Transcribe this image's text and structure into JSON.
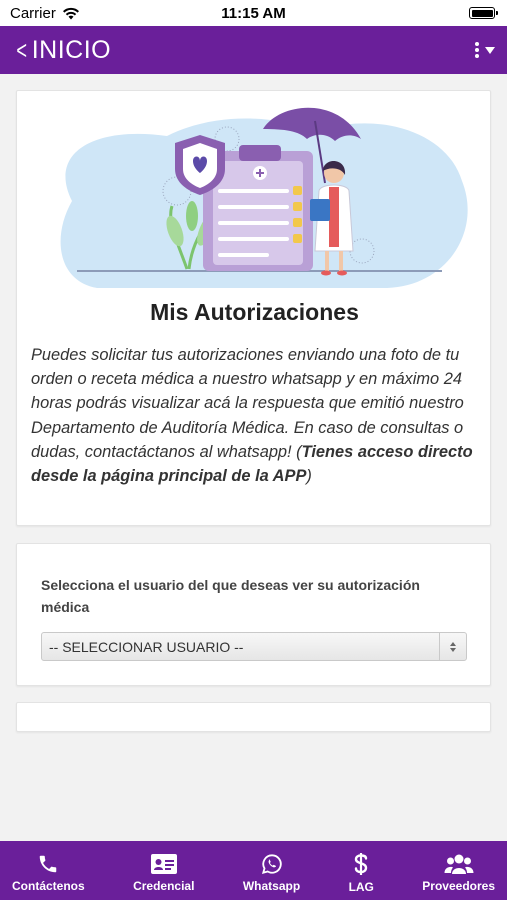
{
  "status_bar": {
    "carrier": "Carrier",
    "time": "11:15 AM"
  },
  "header": {
    "back_label": "INICIO",
    "back_icon": "chevron-left-icon",
    "menu_icon": "kebab-menu-icon"
  },
  "main_card": {
    "title": "Mis Autorizaciones",
    "description_regular": "Puedes solicitar tus autorizaciones enviando una foto de tu orden o receta médica a nuestro whatsapp y en máximo 24 horas podrás visualizar acá la respuesta que emitió nuestro Departamento de Auditoría Médica. En caso de consultas o dudas, contactáctanos al whatsapp!",
    "description_open": "(",
    "description_bold": "Tienes acceso directo desde la página principal de la APP",
    "description_close": ")"
  },
  "select_card": {
    "label": "Selecciona el usuario del que deseas ver su autorización médica",
    "selected_value": "-- SELECCIONAR USUARIO --"
  },
  "tabs": [
    {
      "label": "Contáctenos",
      "icon": "phone-icon"
    },
    {
      "label": "Credencial",
      "icon": "id-card-icon"
    },
    {
      "label": "Whatsapp",
      "icon": "whatsapp-icon"
    },
    {
      "label": "LAG",
      "icon": "dollar-icon"
    },
    {
      "label": "Proveedores",
      "icon": "users-icon"
    }
  ],
  "colors": {
    "brand": "#6a1f9a",
    "illustration_blue": "#cfe6f7",
    "illustration_purple": "#8a5fb0"
  }
}
